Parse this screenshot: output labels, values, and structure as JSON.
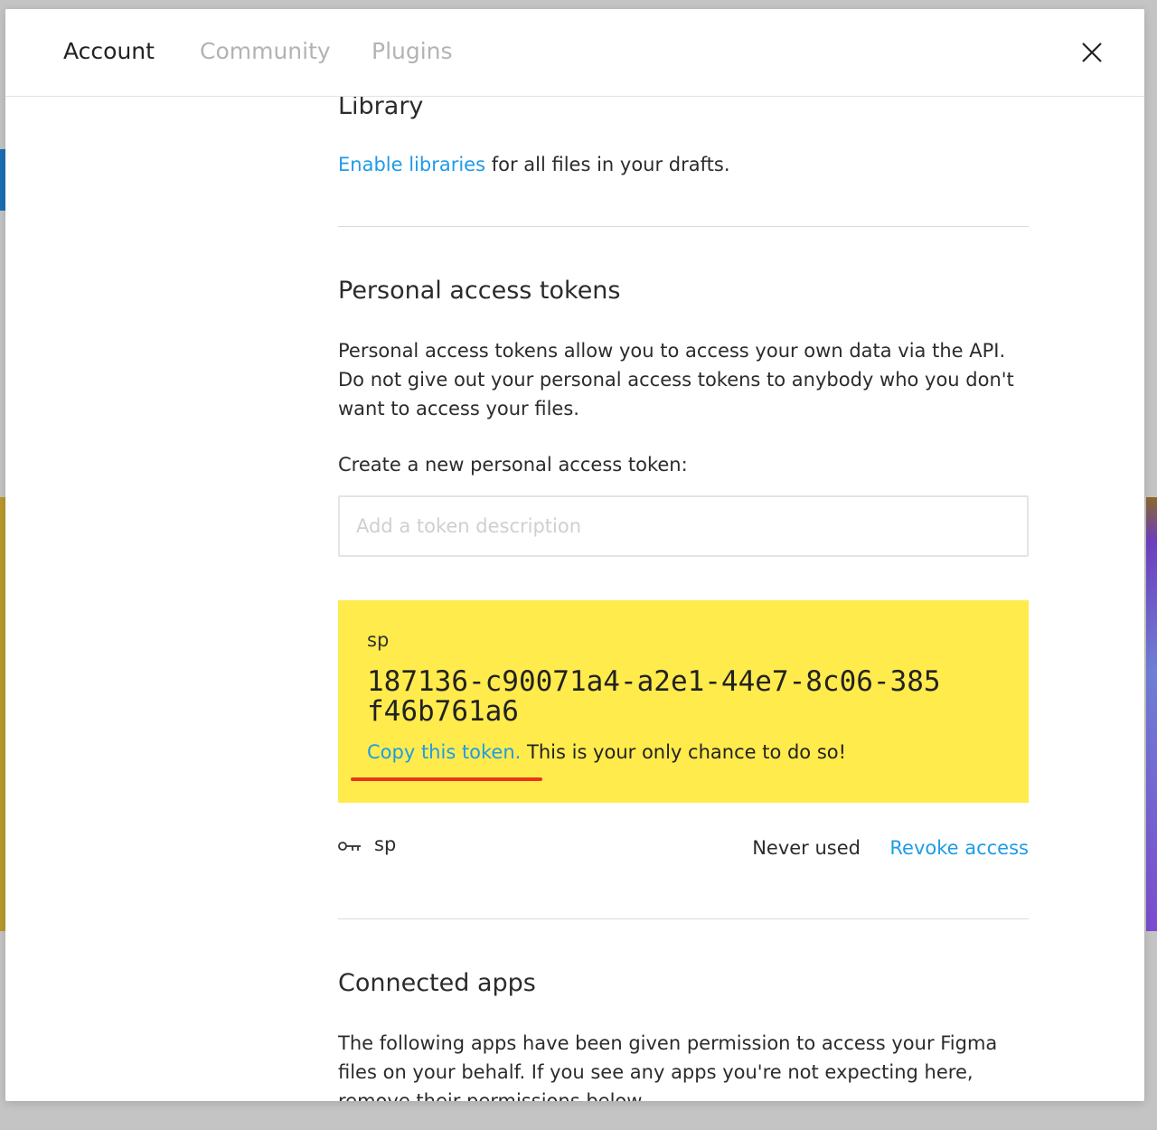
{
  "tabs": [
    {
      "label": "Account",
      "active": true
    },
    {
      "label": "Community",
      "active": false
    },
    {
      "label": "Plugins",
      "active": false
    }
  ],
  "library": {
    "title": "Library",
    "link": "Enable libraries",
    "text": " for all files in your drafts."
  },
  "tokens": {
    "title": "Personal access tokens",
    "description": "Personal access tokens allow you to access your own data via the API. Do not give out your personal access tokens to anybody who you don't want to access your files.",
    "create_label": "Create a new personal access token:",
    "input_placeholder": "Add a token description",
    "new_token": {
      "name": "sp",
      "value": "187136-c90071a4-a2e1-44e7-8c06-385f46b761a6",
      "copy_link": "Copy this token.",
      "warning": " This is your only chance to do so!"
    },
    "list": [
      {
        "name": "sp",
        "last_used": "Never used",
        "action": "Revoke access"
      }
    ]
  },
  "apps": {
    "title": "Connected apps",
    "description": "The following apps have been given permission to access your Figma files on your behalf. If you see any apps you're not expecting here, remove their permissions below."
  },
  "colors": {
    "link": "#1e9be8",
    "token_highlight": "#ffeb4c",
    "annotation_underline": "#e8361f"
  }
}
